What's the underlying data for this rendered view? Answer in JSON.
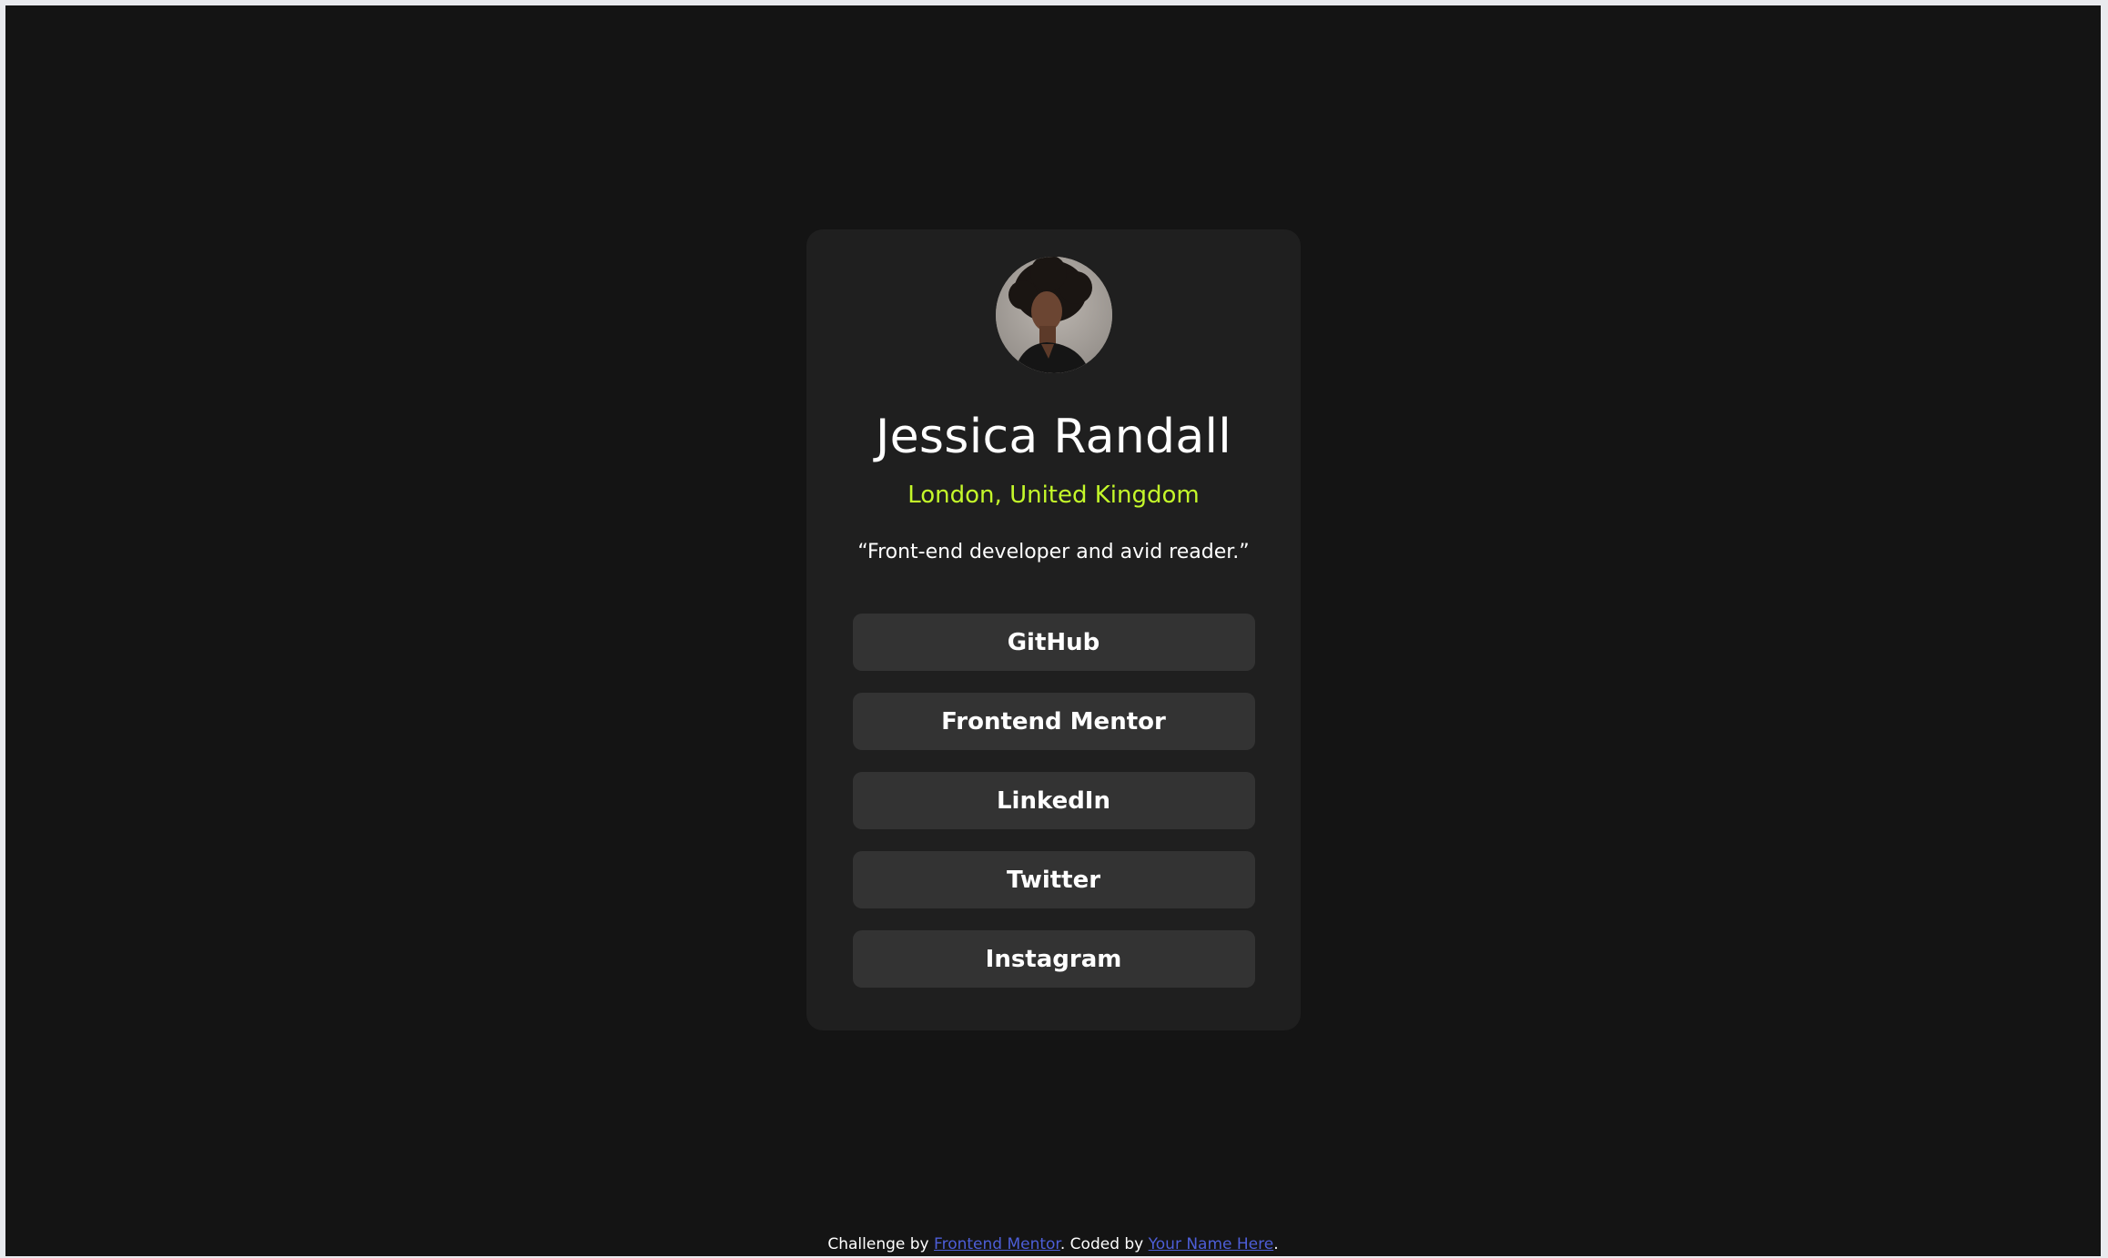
{
  "profile": {
    "name": "Jessica Randall",
    "location": "London, United Kingdom",
    "bio": "“Front-end developer and avid reader.”"
  },
  "links": [
    {
      "label": "GitHub"
    },
    {
      "label": "Frontend Mentor"
    },
    {
      "label": "LinkedIn"
    },
    {
      "label": "Twitter"
    },
    {
      "label": "Instagram"
    }
  ],
  "attribution": {
    "prefix": "Challenge by ",
    "challenge_link": "Frontend Mentor",
    "middle": ". Coded by ",
    "author_link": "Your Name Here",
    "suffix": "."
  },
  "colors": {
    "background": "#141414",
    "card": "#1f1f1f",
    "button": "#333333",
    "accent": "#c4f82a",
    "link": "#4d5ed8"
  },
  "icons": {
    "avatar": "profile-photo"
  }
}
